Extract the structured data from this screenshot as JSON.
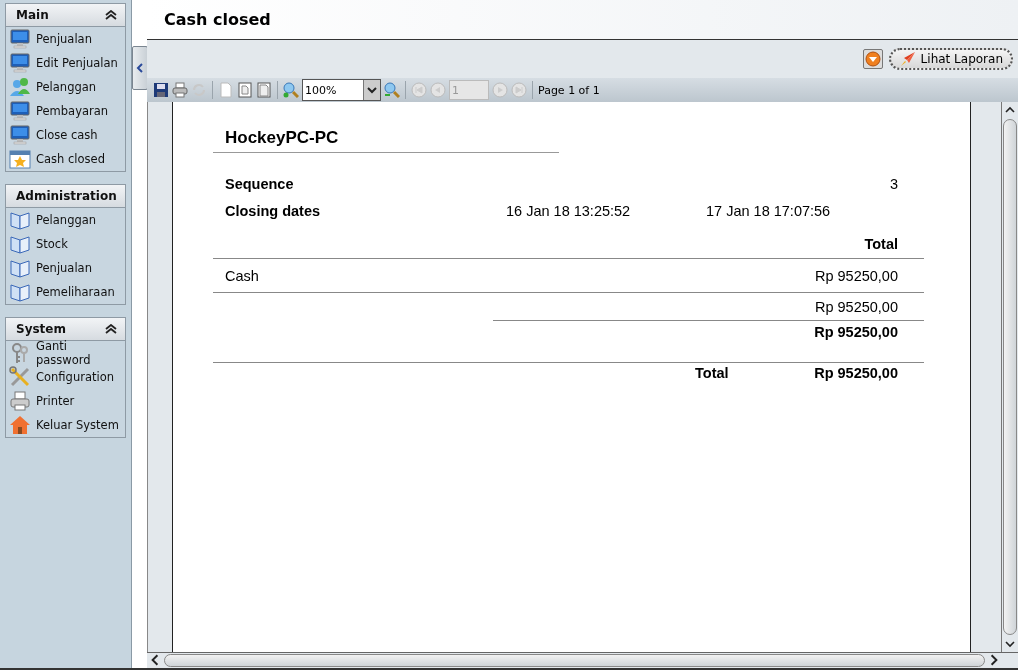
{
  "sidebar": {
    "sections": [
      {
        "title": "Main",
        "expanded": true,
        "items": [
          {
            "label": "Penjualan",
            "kind": "monitor"
          },
          {
            "label": "Edit Penjualan",
            "kind": "monitor"
          },
          {
            "label": "Pelanggan",
            "kind": "people"
          },
          {
            "label": "Pembayaran",
            "kind": "monitor"
          },
          {
            "label": "Close cash",
            "kind": "monitor"
          },
          {
            "label": "Cash closed",
            "kind": "calendar"
          }
        ]
      },
      {
        "title": "Administration",
        "expanded": true,
        "items": [
          {
            "label": "Pelanggan",
            "kind": "book"
          },
          {
            "label": "Stock",
            "kind": "book"
          },
          {
            "label": "Penjualan",
            "kind": "book"
          },
          {
            "label": "Pemeliharaan",
            "kind": "book"
          }
        ]
      },
      {
        "title": "System",
        "expanded": true,
        "items": [
          {
            "label": "Ganti password",
            "kind": "keys"
          },
          {
            "label": "Configuration",
            "kind": "tools"
          },
          {
            "label": "Printer",
            "kind": "printer"
          },
          {
            "label": "Keluar System",
            "kind": "house"
          }
        ]
      }
    ]
  },
  "page_title": "Cash closed",
  "report_button": {
    "label": "Lihat Laporan"
  },
  "toolbar": {
    "zoom": "100%",
    "page_input": "1",
    "page_label": "Page 1 of 1"
  },
  "report": {
    "host": "HockeyPC-PC",
    "sequence": {
      "label": "Sequence",
      "value": "3"
    },
    "closing": {
      "label": "Closing dates",
      "from": "16 Jan 18 13:25:52",
      "to": "17 Jan 18 17:07:56"
    },
    "total_header": "Total",
    "payments": [
      {
        "label": "Cash",
        "amount": "Rp 95250,00"
      }
    ],
    "subtotal": "Rp 95250,00",
    "section_total": "Rp 95250,00",
    "grand_total": {
      "label": "Total",
      "amount": "Rp 95250,00"
    }
  }
}
